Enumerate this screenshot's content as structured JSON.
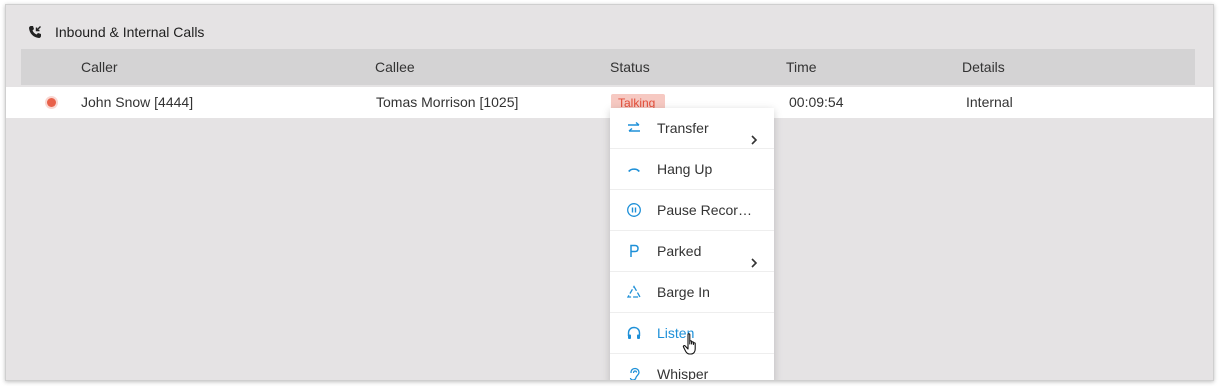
{
  "panel": {
    "title": "Inbound & Internal Calls",
    "icon": "phone-incoming-icon"
  },
  "table": {
    "headers": [
      "Caller",
      "Callee",
      "Status",
      "Time",
      "Details"
    ],
    "rows": [
      {
        "caller": "John Snow [4444]",
        "callee": "Tomas Morrison [1025]",
        "status": "Talking",
        "time": "00:09:54",
        "details": "Internal"
      }
    ]
  },
  "context_menu": {
    "items": [
      {
        "label": "Transfer",
        "icon": "transfer-arrows-icon",
        "submenu": true
      },
      {
        "label": "Hang Up",
        "icon": "hang-up-icon",
        "submenu": false
      },
      {
        "label": "Pause Recordi...",
        "icon": "pause-circle-icon",
        "submenu": false
      },
      {
        "label": "Parked",
        "icon": "park-p-icon",
        "submenu": true
      },
      {
        "label": "Barge In",
        "icon": "barge-in-icon",
        "submenu": false
      },
      {
        "label": "Listen",
        "icon": "headphones-icon",
        "submenu": false,
        "hovered": true
      },
      {
        "label": "Whisper",
        "icon": "whisper-ear-icon",
        "submenu": true
      }
    ]
  },
  "colors": {
    "accent": "#1e90d8",
    "status_talking_bg": "#f6c9c2",
    "status_talking_text": "#e24c38",
    "panel_bg": "#e5e3e4",
    "header_bg": "#d4d3d4"
  }
}
